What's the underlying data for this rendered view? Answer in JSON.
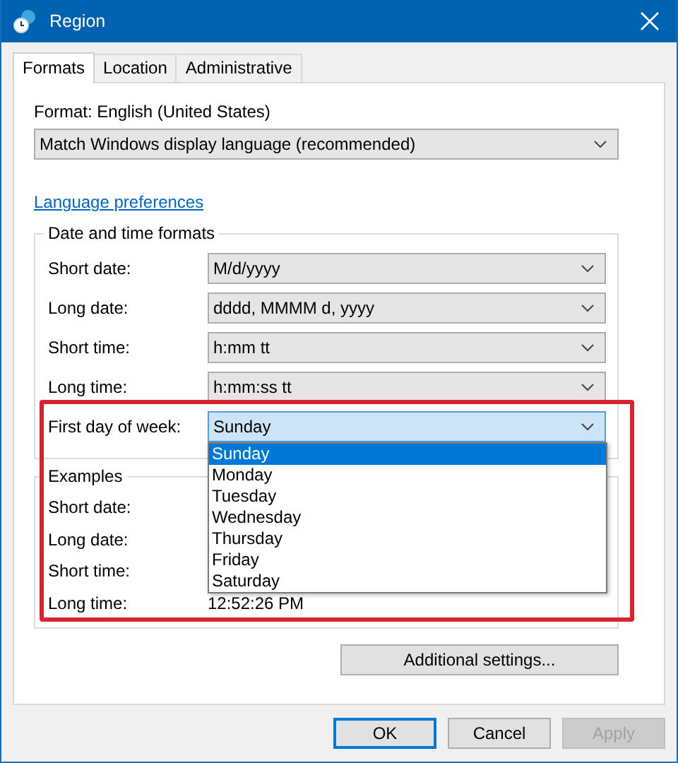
{
  "window": {
    "title": "Region"
  },
  "tabs": [
    {
      "label": "Formats",
      "selected": true
    },
    {
      "label": "Location",
      "selected": false
    },
    {
      "label": "Administrative",
      "selected": false
    }
  ],
  "format": {
    "label": "Format: English (United States)",
    "value": "Match Windows display language (recommended)"
  },
  "link": "Language preferences",
  "date_time_formats": {
    "title": "Date and time formats",
    "fields": [
      {
        "label": "Short date:",
        "value": "M/d/yyyy",
        "open": false
      },
      {
        "label": "Long date:",
        "value": "dddd, MMMM d, yyyy",
        "open": false
      },
      {
        "label": "Short time:",
        "value": "h:mm tt",
        "open": false
      },
      {
        "label": "Long time:",
        "value": "h:mm:ss tt",
        "open": false
      },
      {
        "label": "First day of week:",
        "value": "Sunday",
        "open": true,
        "options": [
          {
            "label": "Sunday",
            "selected": true
          },
          {
            "label": "Monday",
            "selected": false
          },
          {
            "label": "Tuesday",
            "selected": false
          },
          {
            "label": "Wednesday",
            "selected": false
          },
          {
            "label": "Thursday",
            "selected": false
          },
          {
            "label": "Friday",
            "selected": false
          },
          {
            "label": "Saturday",
            "selected": false
          }
        ]
      }
    ]
  },
  "examples": {
    "title": "Examples",
    "rows": [
      {
        "label": "Short date:"
      },
      {
        "label": "Long date:"
      },
      {
        "label": "Short time:"
      },
      {
        "label": "Long time:",
        "value": "12:52:26 PM"
      }
    ]
  },
  "additional_button": "Additional settings...",
  "highlight": true,
  "buttons": [
    {
      "label": "OK",
      "default": true,
      "disabled": false
    },
    {
      "label": "Cancel",
      "default": false,
      "disabled": false
    },
    {
      "label": "Apply",
      "default": false,
      "disabled": true
    }
  ]
}
